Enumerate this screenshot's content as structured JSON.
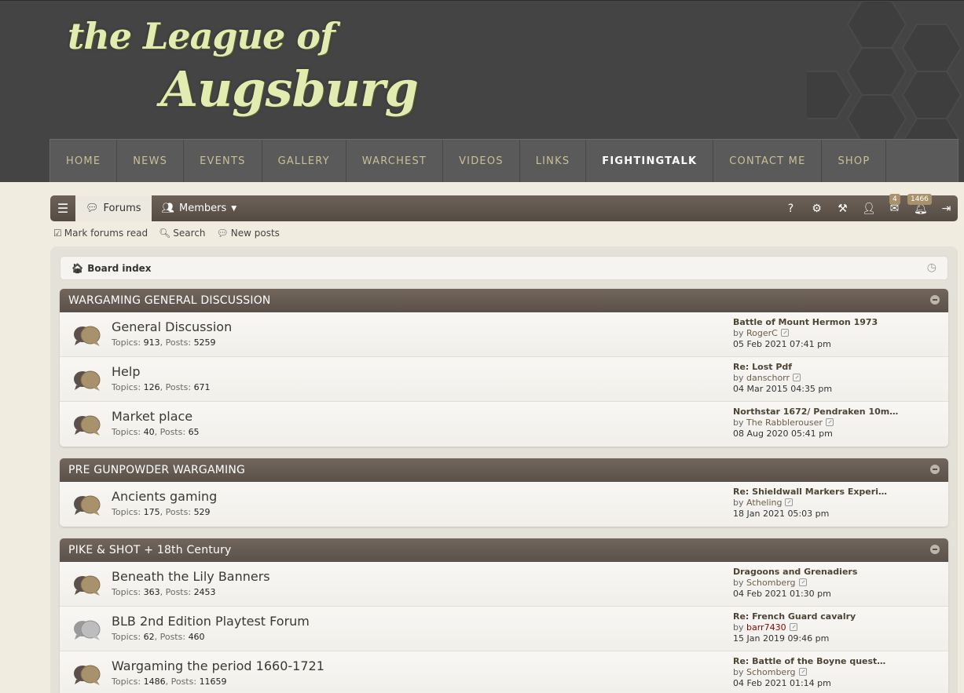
{
  "site": {
    "logo_line1": "the League of",
    "logo_line2": "Augsburg",
    "nav": [
      "HOME",
      "NEWS",
      "EVENTS",
      "GALLERY",
      "WARCHEST",
      "VIDEOS",
      "LINKS",
      "FIGHTINGTALK",
      "CONTACT ME",
      "SHOP"
    ],
    "nav_active": "FIGHTINGTALK"
  },
  "navbar": {
    "forums_label": "Forums",
    "members_label": "Members",
    "inbox_badge": "4",
    "notifications_badge": "1466",
    "icons": [
      "question-icon",
      "ucp-gears-icon",
      "moderator-gavel-icon",
      "user-icon",
      "inbox-icon",
      "bell-icon",
      "logout-icon"
    ]
  },
  "quick_links": {
    "mark_read": "Mark forums read",
    "search": "Search",
    "new_posts": "New posts"
  },
  "breadcrumb": {
    "board_index": "Board index"
  },
  "categories": [
    {
      "title": "WARGAMING GENERAL DISCUSSION",
      "forums": [
        {
          "name": "General Discussion",
          "topics": "913",
          "posts": "5259",
          "last_title": "Battle of Mount Hermon 1973",
          "last_by": "RogerC",
          "last_date": "05 Feb 2021 07:41 pm",
          "unread": true,
          "user_color": "normal"
        },
        {
          "name": "Help",
          "topics": "126",
          "posts": "671",
          "last_title": "Re: Lost Pdf",
          "last_by": "danschorr",
          "last_date": "04 Mar 2015 04:35 pm",
          "unread": true,
          "user_color": "normal"
        },
        {
          "name": "Market place",
          "topics": "40",
          "posts": "65",
          "last_title": "Northstar 1672/ Pendraken 10m…",
          "last_by": "The Rabblerouser",
          "last_date": "08 Aug 2020 05:41 pm",
          "unread": true,
          "user_color": "normal"
        }
      ]
    },
    {
      "title": "PRE GUNPOWDER WARGAMING",
      "forums": [
        {
          "name": "Ancients gaming",
          "topics": "175",
          "posts": "529",
          "last_title": "Re: Shieldwall Markers Experi…",
          "last_by": "Atheling",
          "last_date": "18 Jan 2021 05:03 pm",
          "unread": true,
          "user_color": "normal"
        }
      ]
    },
    {
      "title": "PIKE & SHOT + 18th Century",
      "forums": [
        {
          "name": "Beneath the Lily Banners",
          "topics": "363",
          "posts": "2453",
          "last_title": "Dragoons and Grenadiers",
          "last_by": "Schomberg",
          "last_date": "04 Feb 2021 01:30 pm",
          "unread": true,
          "user_color": "normal"
        },
        {
          "name": "BLB 2nd Edition Playtest Forum",
          "topics": "62",
          "posts": "460",
          "last_title": "Re: French Guard cavalry",
          "last_by": "barr7430",
          "last_date": "15 Jan 2019 09:46 pm",
          "unread": false,
          "user_color": "red"
        },
        {
          "name": "Wargaming the period 1660-1721",
          "topics": "1486",
          "posts": "11659",
          "last_title": "Re: Battle of the Boyne quest…",
          "last_by": "Schomberg",
          "last_date": "04 Feb 2021 01:14 pm",
          "unread": true,
          "user_color": "normal"
        }
      ]
    }
  ],
  "labels": {
    "topics": "Topics:",
    "posts": "Posts:",
    "by": "by"
  },
  "colors": {
    "header_bg": "#444444",
    "nav_text": "#cbbf95",
    "cat_head": "#5b514a",
    "accent": "#a8926b",
    "page_bg": "#f0ece0"
  }
}
